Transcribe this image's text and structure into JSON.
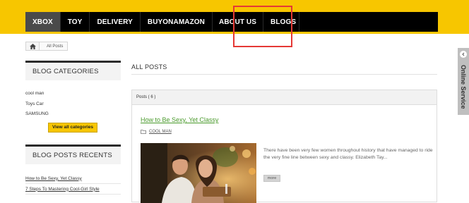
{
  "nav": {
    "items": [
      {
        "label": "XBOX"
      },
      {
        "label": "TOY"
      },
      {
        "label": "DELIVERY"
      },
      {
        "label": "BUYONAMAZON"
      },
      {
        "label": "ABOUT US"
      },
      {
        "label": "BLOGS"
      }
    ]
  },
  "breadcrumb": {
    "current": "All Posts"
  },
  "sidebar": {
    "categories_title": "BLOG CATEGORIES",
    "categories": [
      "cool man",
      "Toys Car",
      "SAMSUNG"
    ],
    "view_all_label": "View all categories",
    "recents_title": "BLOG POSTS RECENTS",
    "recents": [
      "How to Be Sexy, Yet Classy",
      "7 Steps To Mastering Cool-Girl Style"
    ]
  },
  "main": {
    "title": "ALL POSTS",
    "posts_count_label": "Posts ( 6 )",
    "post": {
      "title": "How to Be Sexy, Yet Classy",
      "category": "COOL MAN",
      "excerpt": "There have been very few women throughout history that have managed to ride the very fine line between sexy and classy. Elizabeth Tay...",
      "more_label": "more"
    }
  },
  "service": {
    "label": "Online Service"
  },
  "colors": {
    "brand_yellow": "#f7c600",
    "nav_bg": "#000000",
    "link_green": "#4a9a2c",
    "highlight_red": "#e53935"
  }
}
